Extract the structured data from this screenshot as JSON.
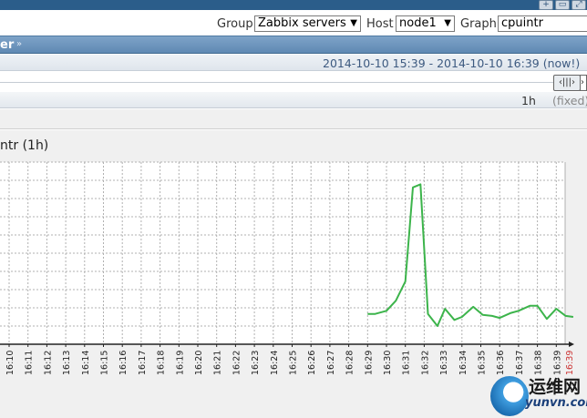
{
  "filters": {
    "group_label": "Group",
    "group_value": "Zabbix servers",
    "host_label": "Host",
    "host_value": "node1",
    "graph_label": "Graph",
    "graph_value": "cpuintr"
  },
  "section": {
    "title": "er",
    "toggle_icon": "double-chevron-up-icon"
  },
  "period": {
    "text": "2014-10-10 15:39  -  2014-10-10 16:39  (now!)"
  },
  "zoom": {
    "value": "1h",
    "fixed_label": "(fixed)"
  },
  "graph": {
    "title": "ntr (1h)"
  },
  "watermark": {
    "brand": "运维网",
    "url": "yunvn.com"
  },
  "colors": {
    "line": "#3cb44b",
    "grid": "#b0b0b0",
    "axis": "#222222",
    "now_label": "#cc3333",
    "header": "#5f89b3"
  },
  "chart_data": {
    "type": "line",
    "x_tick_labels": [
      "16:10",
      "16:11",
      "16:12",
      "16:13",
      "16:14",
      "16:15",
      "16:16",
      "16:17",
      "16:18",
      "16:19",
      "16:20",
      "16:21",
      "16:22",
      "16:23",
      "16:24",
      "16:25",
      "16:26",
      "16:27",
      "16:28",
      "16:29",
      "16:30",
      "16:31",
      "16:32",
      "16:33",
      "16:34",
      "16:35",
      "16:36",
      "16:37",
      "16:38",
      "16:39"
    ],
    "now_label": "16:39",
    "grid": true,
    "series": [
      {
        "x": [
          29.0,
          29.4,
          30.0,
          30.5,
          31.0,
          31.4,
          31.8,
          32.2,
          32.7,
          33.1,
          33.6,
          34.0,
          34.6,
          35.1,
          35.6,
          36.0,
          36.6,
          37.0,
          37.6,
          38.0,
          38.5,
          39.0,
          39.5,
          39.9
        ],
        "y": [
          0.3,
          0.3,
          0.33,
          0.43,
          0.62,
          1.55,
          1.58,
          0.3,
          0.18,
          0.35,
          0.24,
          0.27,
          0.37,
          0.29,
          0.28,
          0.26,
          0.31,
          0.33,
          0.38,
          0.38,
          0.25,
          0.35,
          0.28,
          0.27
        ]
      }
    ],
    "ylim": [
      0,
      1.8
    ]
  }
}
